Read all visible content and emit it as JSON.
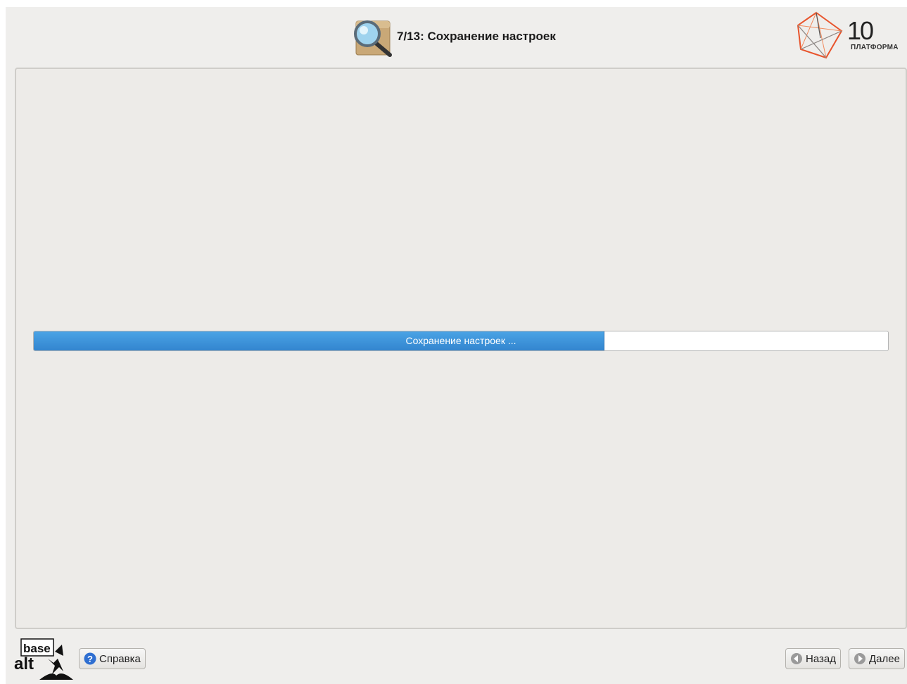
{
  "header": {
    "step_title": "7/13: Сохранение настроек",
    "brand_number": "10",
    "brand_name": "ПЛАТФОРМА"
  },
  "progress": {
    "label": "Сохранение настроек ...",
    "percent": 66.7
  },
  "footer": {
    "logo_text_top": "base",
    "logo_text_bottom": "alt",
    "help_label": "Справка",
    "back_label": "Назад",
    "next_label": "Далее"
  },
  "colors": {
    "window_bg": "#efeeec",
    "progress_fill": "#3a8fd8",
    "brand_accent": "#e8532b"
  },
  "icons": {
    "step": "magnifier-box-icon",
    "help": "help-icon",
    "back": "arrow-left-icon",
    "next": "arrow-right-icon"
  }
}
